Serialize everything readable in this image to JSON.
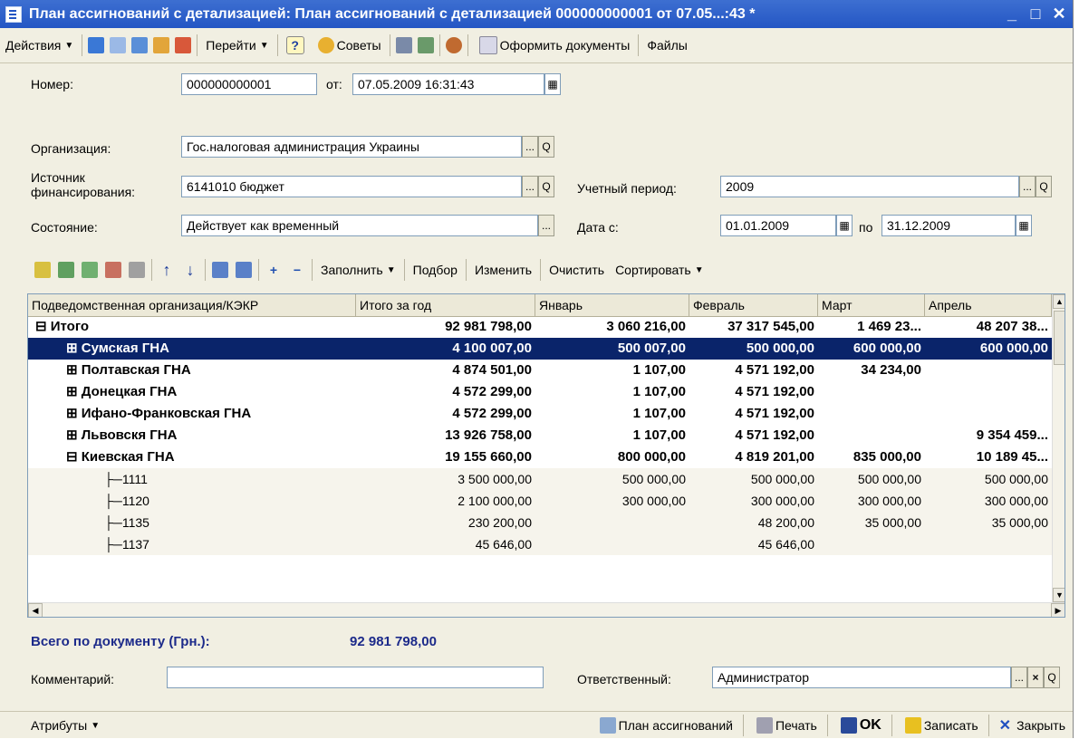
{
  "window": {
    "title": "План ассигнований с детализацией: План ассигнований с детализацией 000000000001 от 07.05...:43 *",
    "minimize": "_",
    "maximize": "□",
    "close": "✕"
  },
  "toolbar": {
    "actions": "Действия",
    "goto": "Перейти",
    "help": "?",
    "tips": "Советы",
    "make_docs": "Оформить документы",
    "files": "Файлы"
  },
  "form": {
    "number_label": "Номер:",
    "number_value": "000000000001",
    "from_label": "от:",
    "date_value": "07.05.2009 16:31:43",
    "org_label": "Организация:",
    "org_value": "Гос.налоговая администрация Украины",
    "source_label_1": "Источник",
    "source_label_2": "финансирования:",
    "source_value": "6141010 бюджет",
    "period_label": "Учетный период:",
    "period_value": "2009",
    "state_label": "Состояние:",
    "state_value": "Действует как временный",
    "date_from_label": "Дата с:",
    "date_from_value": "01.01.2009",
    "date_to_label": "по",
    "date_to_value": "31.12.2009",
    "ellipsis": "...",
    "search": "Q"
  },
  "grid_toolbar": {
    "fill": "Заполнить",
    "pick": "Подбор",
    "change": "Изменить",
    "clear": "Очистить",
    "sort": "Сортировать"
  },
  "grid": {
    "columns": [
      "Подведомственная организация/КЭКР",
      "Итого за год",
      "Январь",
      "Февраль",
      "Март",
      "Апрель"
    ],
    "rows": [
      {
        "name": "Итого",
        "expander": "⊟",
        "total": "92 981 798,00",
        "jan": "3 060 216,00",
        "feb": "37 317 545,00",
        "mar": "1 469 23...",
        "apr": "48 207 38..."
      },
      {
        "name": "Сумская ГНА",
        "expander": "⊞",
        "total": "4 100 007,00",
        "jan": "500 007,00",
        "feb": "500 000,00",
        "mar": "600 000,00",
        "apr": "600 000,00"
      },
      {
        "name": "Полтавская ГНА",
        "expander": "⊞",
        "total": "4 874 501,00",
        "jan": "1 107,00",
        "feb": "4 571 192,00",
        "mar": "34 234,00",
        "apr": ""
      },
      {
        "name": "Донецкая ГНА",
        "expander": "⊞",
        "total": "4 572 299,00",
        "jan": "1 107,00",
        "feb": "4 571 192,00",
        "mar": "",
        "apr": ""
      },
      {
        "name": "Ифано-Франковская ГНА",
        "expander": "⊞",
        "total": "4 572 299,00",
        "jan": "1 107,00",
        "feb": "4 571 192,00",
        "mar": "",
        "apr": ""
      },
      {
        "name": "Львовскя ГНА",
        "expander": "⊞",
        "total": "13 926 758,00",
        "jan": "1 107,00",
        "feb": "4 571 192,00",
        "mar": "",
        "apr": "9 354 459..."
      },
      {
        "name": "Киевская ГНА",
        "expander": "⊟",
        "total": "19 155 660,00",
        "jan": "800 000,00",
        "feb": "4 819 201,00",
        "mar": "835 000,00",
        "apr": "10 189 45..."
      },
      {
        "name": "1111",
        "total": "3 500 000,00",
        "jan": "500 000,00",
        "feb": "500 000,00",
        "mar": "500 000,00",
        "apr": "500 000,00"
      },
      {
        "name": "1120",
        "total": "2 100 000,00",
        "jan": "300 000,00",
        "feb": "300 000,00",
        "mar": "300 000,00",
        "apr": "300 000,00"
      },
      {
        "name": "1135",
        "total": "230 200,00",
        "jan": "",
        "feb": "48 200,00",
        "mar": "35 000,00",
        "apr": "35 000,00"
      },
      {
        "name": "1137",
        "total": "45 646,00",
        "jan": "",
        "feb": "45 646,00",
        "mar": "",
        "apr": ""
      }
    ]
  },
  "totals": {
    "label": "Всего по документу (Грн.):",
    "value": "92 981 798,00"
  },
  "bottom": {
    "comment_label": "Комментарий:",
    "comment_value": "",
    "responsible_label": "Ответственный:",
    "responsible_value": "Администратор",
    "clear": "×"
  },
  "statusbar": {
    "attributes": "Атрибуты",
    "plan": "План ассигнований",
    "print": "Печать",
    "ok": "OK",
    "save": "Записать",
    "close": "Закрыть"
  },
  "colors": {
    "title_bar": "#2456c4",
    "selection": "#0a246a",
    "total_text": "#1c2a8a",
    "window_bg": "#f1efe2"
  }
}
